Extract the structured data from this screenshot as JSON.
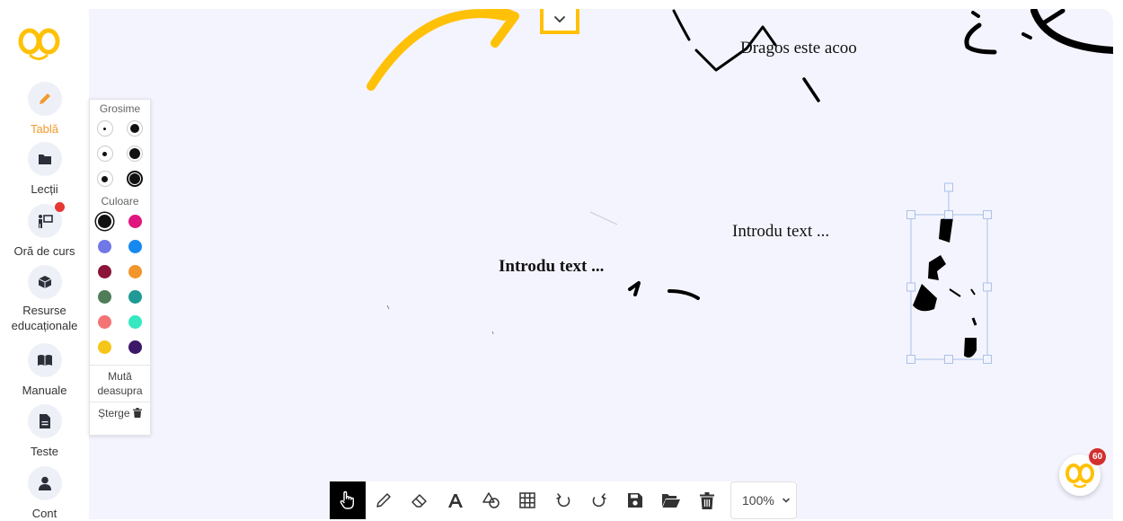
{
  "sidebar": {
    "items": [
      {
        "label": "Tablă",
        "icon": "pencil-icon",
        "active": true
      },
      {
        "label": "Lecții",
        "icon": "folder-icon"
      },
      {
        "label": "Oră de curs",
        "icon": "teacher-board-icon",
        "badge": true
      },
      {
        "label": "Resurse educaționale",
        "icon": "cube-icon"
      },
      {
        "label": "Manuale",
        "icon": "book-icon"
      },
      {
        "label": "Teste",
        "icon": "document-icon"
      },
      {
        "label": "Cont",
        "icon": "user-icon"
      }
    ]
  },
  "panel": {
    "thickness_label": "Grosime",
    "color_label": "Culoare",
    "colors": [
      "#111111",
      "#e0157f",
      "#6f78e6",
      "#1689f0",
      "#8b1438",
      "#f2952a",
      "#4f7d57",
      "#1f9a94",
      "#f47475",
      "#35e8c2",
      "#f5c518",
      "#3d1768"
    ],
    "bring_front_label": "Mută deasupra",
    "delete_label": "Șterge"
  },
  "board": {
    "texts": [
      "Dragos este acoo",
      "Introdu text ...",
      "Introdu text ..."
    ],
    "accent_color": "#ffc107"
  },
  "toolbar": {
    "tools": [
      "hand-tool",
      "pen-tool",
      "eraser-tool",
      "text-tool",
      "shapes-tool",
      "table-tool",
      "undo",
      "redo",
      "save",
      "open",
      "delete-all"
    ],
    "zoom": "100%"
  },
  "mascot": {
    "badge": "60"
  }
}
